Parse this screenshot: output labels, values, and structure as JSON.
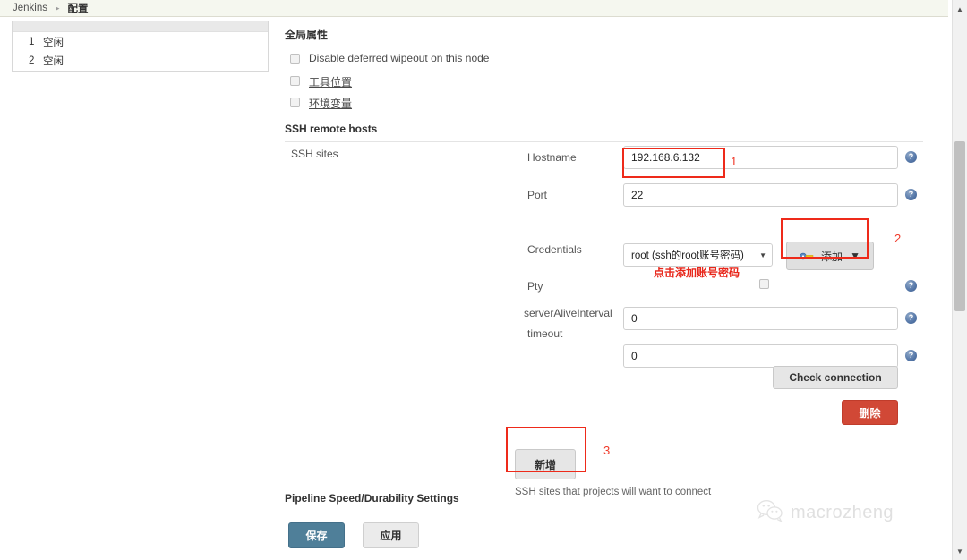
{
  "breadcrumb": {
    "root": "Jenkins",
    "separator": "▸",
    "current": "配置"
  },
  "executors": {
    "rows": [
      {
        "num": "1",
        "state": "空闲"
      },
      {
        "num": "2",
        "state": "空闲"
      }
    ]
  },
  "global_properties": {
    "title": "全局属性",
    "checkboxes": [
      {
        "label": "Disable deferred wipeout on this node",
        "checked": false,
        "link": false
      },
      {
        "label": "工具位置",
        "checked": false,
        "link": true
      },
      {
        "label": "环境变量",
        "checked": false,
        "link": true
      }
    ]
  },
  "ssh_remote_hosts": {
    "title": "SSH remote hosts",
    "group_label": "SSH sites",
    "fields": {
      "hostname": {
        "label": "Hostname",
        "value": "192.168.6.132"
      },
      "port": {
        "label": "Port",
        "value": "22"
      },
      "credentials": {
        "label": "Credentials",
        "selected": "root (ssh的root账号密码)",
        "caret": "▼",
        "add_button": {
          "label": "添加",
          "caret": "▼",
          "icon": "key-icon"
        }
      },
      "pty": {
        "label": "Pty",
        "checked": false
      },
      "server_alive_interval": {
        "label": "serverAliveInterval",
        "value": "0"
      },
      "timeout": {
        "label": "timeout",
        "value": "0"
      }
    },
    "check_connection_label": "Check connection",
    "delete_label": "删除",
    "add_label": "新增",
    "help_text": "SSH sites that projects will want to connect",
    "help_icon_glyph": "?"
  },
  "annotations": {
    "one": "1",
    "two": "2",
    "three": "3",
    "credential_hint": "点击添加账号密码",
    "box_color": "#ee2a1a"
  },
  "pipeline_section": {
    "title": "Pipeline Speed/Durability Settings"
  },
  "form_actions": {
    "save": "保存",
    "apply": "应用"
  },
  "watermark": {
    "text": "macrozheng",
    "icon": "wechat-icon"
  },
  "scrollbar": {
    "up_arrow": "▲",
    "down_arrow": "▼"
  },
  "colors": {
    "accent_blue": "#4f7f99",
    "danger_red": "#d14836",
    "annotation_red": "#ee2a1a",
    "breadcrumb_bg": "#f5f7ef"
  }
}
